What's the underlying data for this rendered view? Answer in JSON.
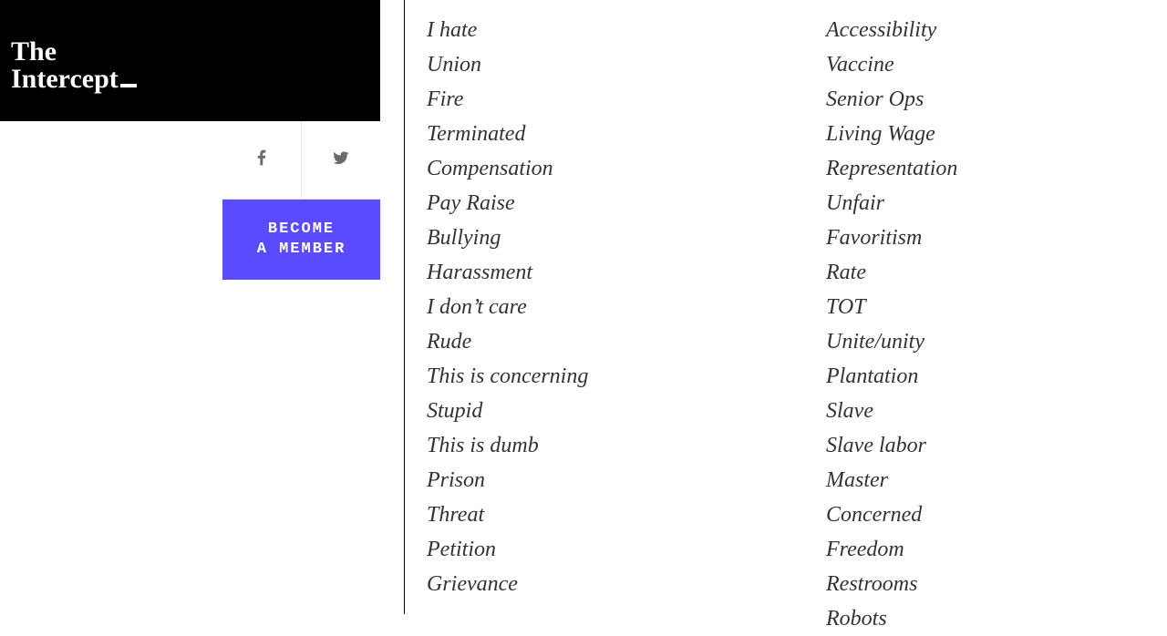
{
  "brand": {
    "line1": "The",
    "line2": "Intercept"
  },
  "sidebar": {
    "share": {
      "facebook": "facebook-icon",
      "twitter": "twitter-icon"
    },
    "member_line1": "BECOME",
    "member_line2": "A MEMBER"
  },
  "terms_left": [
    "I hate",
    "Union",
    "Fire",
    "Terminated",
    "Compensation",
    "Pay Raise",
    "Bullying",
    "Harassment",
    "I don’t care",
    "Rude",
    "This is concerning",
    "Stupid",
    "This is dumb",
    "Prison",
    "Threat",
    "Petition",
    "Grievance"
  ],
  "terms_right": [
    "Accessibility",
    "Vaccine",
    "Senior Ops",
    "Living Wage",
    "Representation",
    "Unfair",
    "Favoritism",
    "Rate",
    "TOT",
    "Unite/unity",
    "Plantation",
    "Slave",
    "Slave labor",
    "Master",
    "Concerned",
    "Freedom",
    "Restrooms",
    "Robots"
  ]
}
